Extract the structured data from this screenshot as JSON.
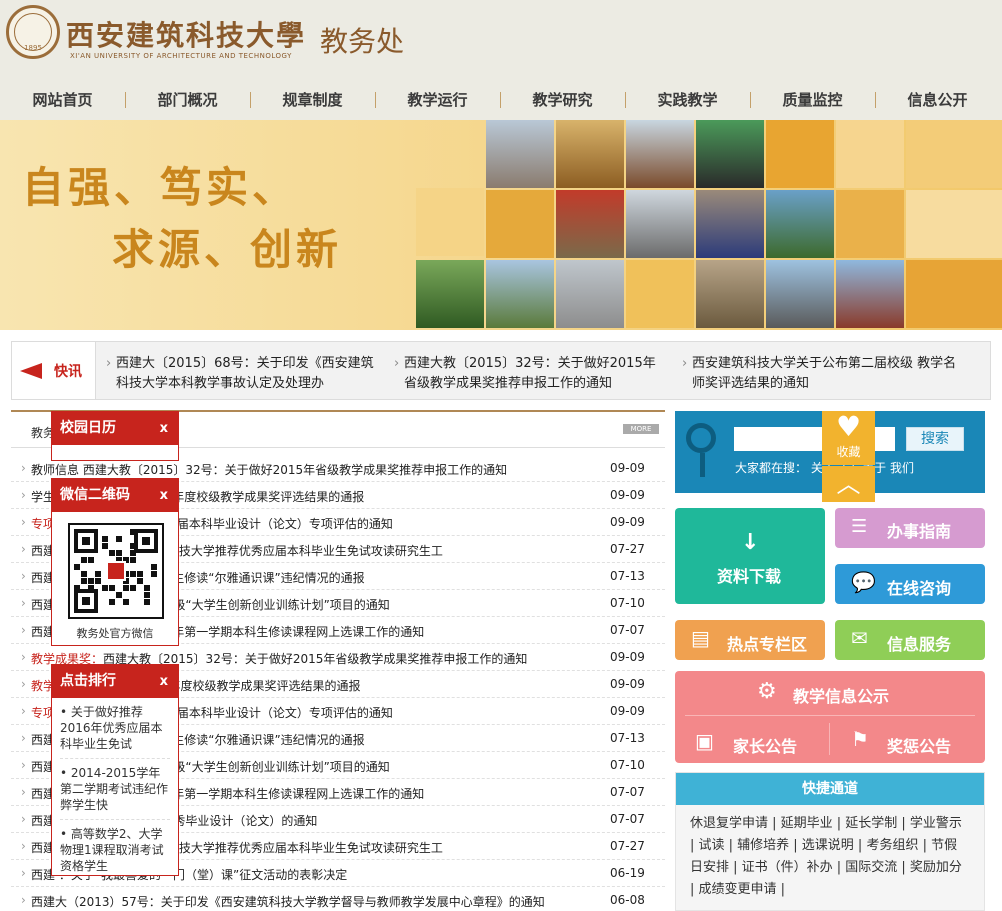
{
  "header": {
    "university_name": "西安建筑科技大學",
    "university_en": "XI'AN UNIVERSITY OF ARCHITECTURE AND TECHNOLOGY",
    "seal_year": "1895",
    "department": "教务处"
  },
  "nav": [
    "网站首页",
    "部门概况",
    "规章制度",
    "教学运行",
    "教学研究",
    "实践教学",
    "质量监控",
    "信息公开"
  ],
  "banner": {
    "slogan_line1": "自强、笃实、",
    "slogan_line2": "求源、创新"
  },
  "ticker": {
    "label": "快讯",
    "items": [
      "西建大〔2015〕68号：关于印发《西安建筑科技大学本科教学事故认定及处理办",
      "西建大教〔2015〕32号：关于做好2015年省级教学成果奖推荐申报工作的通知",
      "西安建筑科技大学关于公布第二届校级 教学名师奖评选结果的通知"
    ]
  },
  "list": {
    "tabs": [
      "教务"
    ],
    "more": "MORE",
    "side_labels": [
      "教务",
      "教师信息",
      "学生"
    ],
    "rows": [
      {
        "tag": "",
        "title": "教师信息 西建大教〔2015〕32号：关于做好2015年省级教学成果奖推荐申报工作的通知",
        "date": "09-09"
      },
      {
        "tag": "",
        "title": "学生 〕148号：关于2015年度校级教学成果奖评选结果的通报",
        "date": "09-09"
      },
      {
        "tag": "专项",
        "title": "〕31号:关于开展2015届本科毕业设计（论文）专项评估的通知",
        "date": "09-09"
      },
      {
        "tag": "",
        "title": "西建 关于印发《西安建筑科技大学推荐优秀应届本科毕业生免试攻读研究生工",
        "date": "07-27"
      },
      {
        "tag": "",
        "title": "西建 于2011-2014级本科生修读“尔雅通识课”违纪情况的通报",
        "date": "07-13"
      },
      {
        "tag": "",
        "title": "西建 开启动我校2015年省级“大学生创新创业训练计划”项目的通知",
        "date": "07-10"
      },
      {
        "tag": "",
        "title": "西建 于做好2015-2016学年第一学期本科生修读课程网上选课工作的通知",
        "date": "07-07"
      },
      {
        "tag": "教学成果奖：",
        "title": "西建大教〔2015〕32号：关于做好2015年省级教学成果奖推荐申报工作的通知",
        "date": "09-09"
      },
      {
        "tag": "教学",
        "title": "〕148号：关于2015年度校级教学成果奖评选结果的通报",
        "date": "09-09"
      },
      {
        "tag": "专项",
        "title": "〕31号:关于开展2015届本科毕业设计（论文）专项评估的通知",
        "date": "09-09"
      },
      {
        "tag": "",
        "title": "西建 于2011-2014级本科生修读“尔雅通识课”违纪情况的通报",
        "date": "07-13"
      },
      {
        "tag": "",
        "title": "西建 开启动我校2015年省级“大学生创新创业训练计划”项目的通知",
        "date": "07-10"
      },
      {
        "tag": "",
        "title": "西建 于做好2015-2016学年第一学期本科生修读课程网上选课工作的通知",
        "date": "07-07"
      },
      {
        "tag": "",
        "title": "西建 于公布2015届本科优秀毕业设计（论文）的通知",
        "date": "07-07"
      },
      {
        "tag": "",
        "title": "西建 关于印发《西安建筑科技大学推荐优秀应届本科毕业生免试攻读研究生工",
        "date": "07-27"
      },
      {
        "tag": "",
        "title": "西建 ：关于“我最喜爱的一门（堂）课”征文活动的表彰决定",
        "date": "06-19"
      },
      {
        "tag": "",
        "title": "西建大（2013）57号：关于印发《西安建筑科技大学教学督导与教师教学发展中心章程》的通知",
        "date": "06-08"
      }
    ]
  },
  "popups": {
    "calendar": {
      "title": "校园日历",
      "close": "x"
    },
    "wechat": {
      "title": "微信二维码",
      "close": "x",
      "caption": "教务处官方微信"
    },
    "ranking": {
      "title": "点击排行",
      "close": "x",
      "items": [
        "关于做好推荐2016年优秀应届本科毕业生免试",
        "2014-2015学年第二学期考试违纪作弊学生快",
        "高等数学2、大学物理1课程取消考试资格学生"
      ]
    }
  },
  "search": {
    "placeholder": "",
    "button": "搜索",
    "hot_label": "大家都在搜：",
    "hot_terms": [
      "关于",
      "学",
      "关于 我们"
    ]
  },
  "favorite": {
    "label": "收藏"
  },
  "tiles": {
    "download": "资料下载",
    "guide": "办事指南",
    "consult": "在线咨询",
    "hot_topics": "热点专栏区",
    "info_service": "信息服务",
    "teaching_info": "教学信息公示",
    "parent_notice": "家长公告",
    "reward_notice": "奖惩公告"
  },
  "quick": {
    "title": "快捷通道",
    "links": "休退复学申请 | 延期毕业 | 延长学制 | 学业警示 | 试读 | 辅修培养 | 选课说明 | 考务组织 | 节假日安排 | 证书（件）补办 | 国际交流 | 奖励加分 | 成绩变更申请 |"
  },
  "colors": {
    "brand": "#8a5a2c",
    "accent_red": "#c7241d",
    "search_blue": "#1a87b7",
    "green": "#1fb89a",
    "purple": "#d69bd0",
    "blue": "#2e9ad8",
    "orange": "#f0a150",
    "lime": "#8fce57",
    "pink": "#f3888a",
    "quick_head": "#3fb2d6"
  }
}
